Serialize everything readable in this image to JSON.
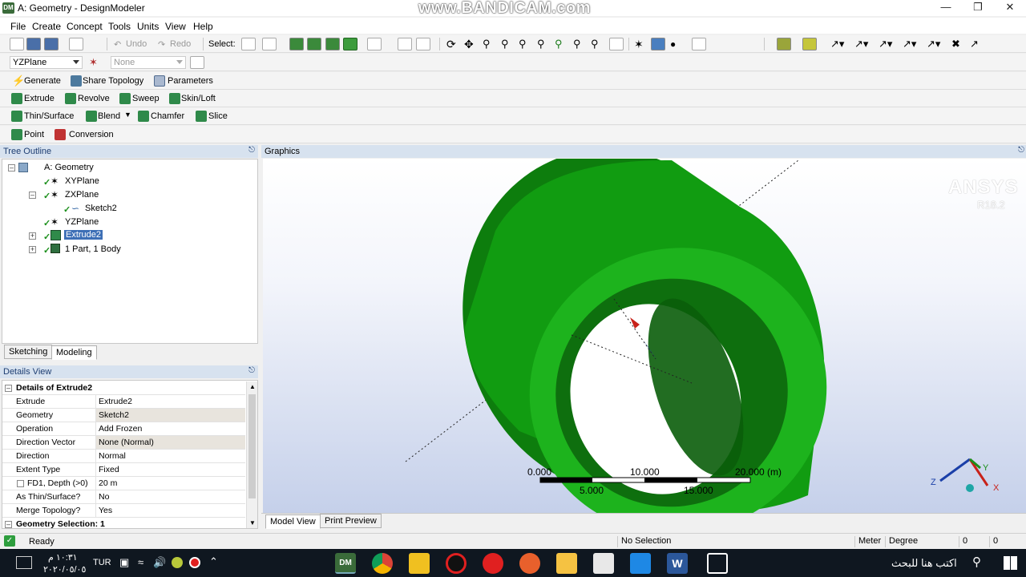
{
  "window": {
    "title": "A: Geometry - DesignModeler",
    "app_badge": "DM",
    "watermark": "www.BANDICAM.com"
  },
  "menu": {
    "items": [
      "File",
      "Create",
      "Concept",
      "Tools",
      "Units",
      "View",
      "Help"
    ]
  },
  "toolbar": {
    "undo_label": "Undo",
    "redo_label": "Redo",
    "select_label": "Select:",
    "plane_combo": "YZPlane",
    "sketch_combo": "None"
  },
  "features": {
    "row1": [
      "Generate",
      "Share Topology",
      "Parameters"
    ],
    "row2": [
      "Extrude",
      "Revolve",
      "Sweep",
      "Skin/Loft"
    ],
    "row3": [
      "Thin/Surface",
      "Blend",
      "Chamfer",
      "Slice"
    ],
    "row4": [
      "Point",
      "Conversion"
    ]
  },
  "tree": {
    "header": "Tree Outline",
    "items": [
      "A: Geometry",
      "XYPlane",
      "ZXPlane",
      "Sketch2",
      "YZPlane",
      "Extrude2",
      "1 Part, 1 Body"
    ],
    "tabs": [
      "Sketching",
      "Modeling"
    ]
  },
  "details": {
    "header": "Details View",
    "section_title": "Details of Extrude2",
    "rows": [
      {
        "label": "Extrude",
        "value": "Extrude2"
      },
      {
        "label": "Geometry",
        "value": "Sketch2"
      },
      {
        "label": "Operation",
        "value": "Add Frozen"
      },
      {
        "label": "Direction Vector",
        "value": "None (Normal)"
      },
      {
        "label": "Direction",
        "value": "Normal"
      },
      {
        "label": "Extent Type",
        "value": "Fixed"
      },
      {
        "label": "FD1, Depth (>0)",
        "value": "20 m"
      },
      {
        "label": "As Thin/Surface?",
        "value": "No"
      },
      {
        "label": "Merge Topology?",
        "value": "Yes"
      }
    ],
    "footer": "Geometry Selection: 1"
  },
  "graphics": {
    "header": "Graphics",
    "brand": "ANSYS",
    "version": "R18.2",
    "scale_top": [
      "0.000",
      "10.000",
      "20.000 (m)"
    ],
    "scale_bottom": [
      "5.000",
      "15.000"
    ],
    "axes": [
      "Z",
      "Y",
      "X"
    ],
    "tabs": [
      "Model View",
      "Print Preview"
    ],
    "body_color": "#1db31d"
  },
  "status": {
    "ready": "Ready",
    "selection": "No Selection",
    "unit_length": "Meter",
    "unit_angle": "Degree",
    "v1": "0",
    "v2": "0"
  },
  "taskbar": {
    "time": "١٠:٣١ م",
    "date": "٢٠٢٠/٠٥/٠٥",
    "lang": "TUR",
    "search": "اكتب هنا للبحث"
  }
}
